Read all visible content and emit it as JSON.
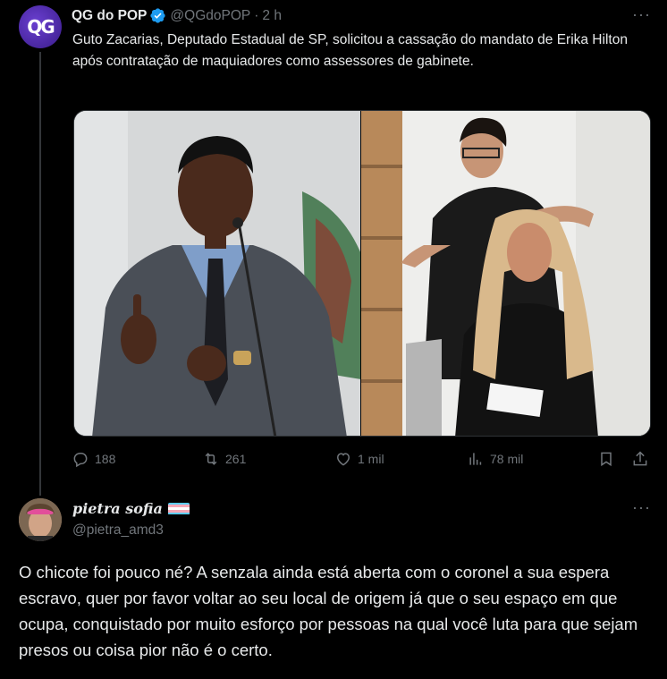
{
  "tweet": {
    "author_name": "QG do POP",
    "author_handle": "@QGdoPOP",
    "time": "2 h",
    "separator": "·",
    "avatar_text": "QG",
    "text": "Guto Zacarias, Deputado Estadual de SP, solicitou a cassação do mandato de Erika Hilton após contratação de maquiadores como assessores de gabinete.",
    "more_label": "···",
    "stats": {
      "replies": "188",
      "reposts": "261",
      "likes": "1 mil",
      "views": "78 mil"
    }
  },
  "reply": {
    "author_name": "pietra sofia",
    "author_handle": "@pietra_amd3",
    "more_label": "···",
    "text": "O chicote foi pouco né? A senzala ainda está aberta com o coronel a sua espera escravo,  quer por favor voltar ao seu local de origem já que o seu espaço em que ocupa, conquistado por muito esforço por pessoas na qual você luta  para que sejam presos ou coisa pior não é o certo."
  },
  "colors": {
    "background": "#000000",
    "text": "#e7e9ea",
    "muted": "#71767b",
    "verified": "#1d9bf0",
    "divider": "#333639"
  },
  "icons": [
    "verified-badge-icon",
    "reply-icon",
    "repost-icon",
    "like-icon",
    "views-icon",
    "bookmark-icon",
    "share-icon",
    "more-icon",
    "trans-flag-icon"
  ]
}
